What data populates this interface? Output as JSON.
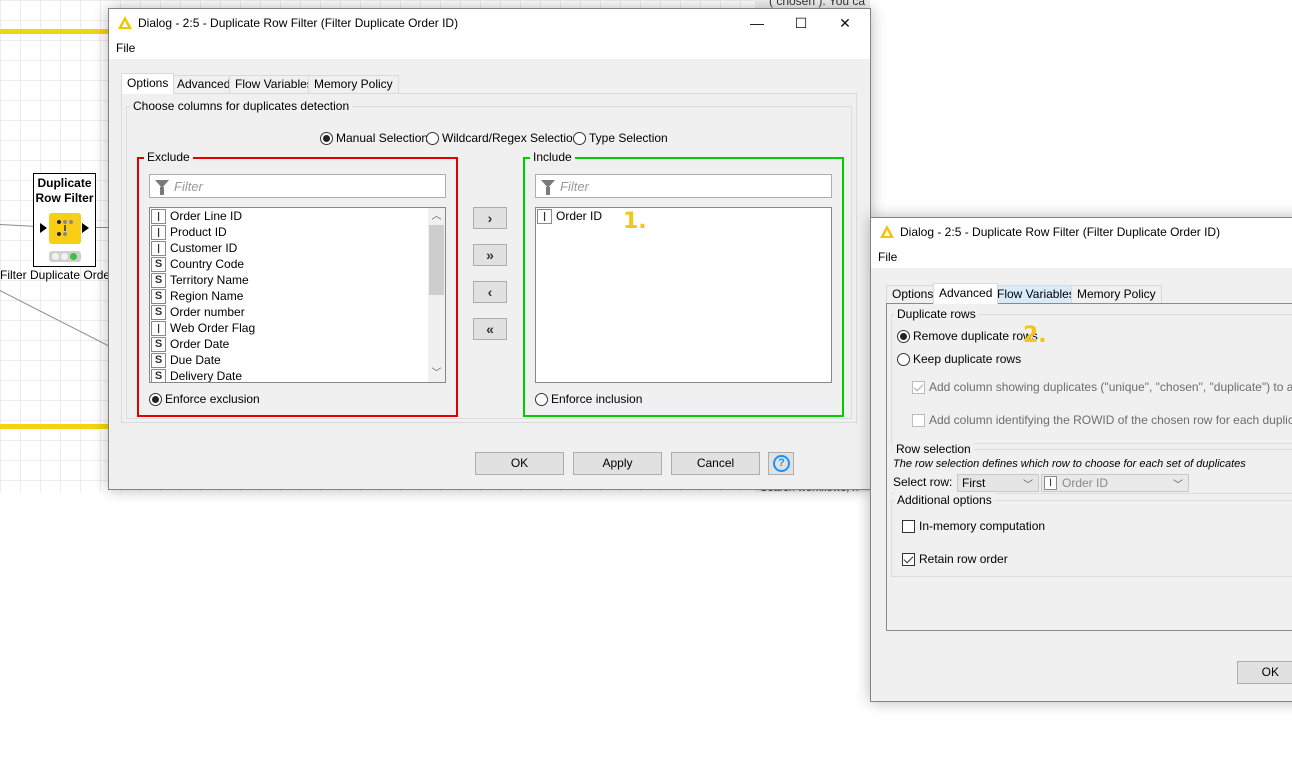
{
  "canvas": {
    "node": {
      "title_line1": "Duplicate",
      "title_line2": "Row Filter",
      "label": "Filter Duplicate Orde"
    },
    "background_snippets": {
      "top_right": "( chosen ). You ca",
      "search_hint": "Search workflows, n"
    }
  },
  "dialog1": {
    "title": "Dialog - 2:5 - Duplicate Row Filter (Filter Duplicate Order ID)",
    "menu": {
      "file": "File"
    },
    "window_controls": {
      "minimize": "—",
      "maximize": "☐",
      "close": "✕"
    },
    "tabs": [
      {
        "label": "Options",
        "active": true
      },
      {
        "label": "Advanced",
        "active": false
      },
      {
        "label": "Flow Variables",
        "active": false
      },
      {
        "label": "Memory Policy",
        "active": false
      }
    ],
    "group_title": "Choose columns for duplicates detection",
    "selection_modes": [
      {
        "label": "Manual Selection",
        "selected": true
      },
      {
        "label": "Wildcard/Regex Selection",
        "selected": false
      },
      {
        "label": "Type Selection",
        "selected": false
      }
    ],
    "exclude": {
      "title": "Exclude",
      "border_color": "#e00000",
      "filter_placeholder": "Filter",
      "items": [
        {
          "type": "I",
          "name": "Order Line ID"
        },
        {
          "type": "I",
          "name": "Product ID"
        },
        {
          "type": "I",
          "name": "Customer ID"
        },
        {
          "type": "S",
          "name": "Country Code"
        },
        {
          "type": "S",
          "name": "Territory Name"
        },
        {
          "type": "S",
          "name": "Region Name"
        },
        {
          "type": "S",
          "name": "Order number"
        },
        {
          "type": "I",
          "name": "Web Order Flag"
        },
        {
          "type": "S",
          "name": "Order Date"
        },
        {
          "type": "S",
          "name": "Due Date"
        },
        {
          "type": "S",
          "name": "Delivery Date"
        }
      ],
      "enforce_label": "Enforce exclusion",
      "enforce_selected": true
    },
    "move_buttons": {
      "add": "›",
      "add_all": "»",
      "remove": "‹",
      "remove_all": "«"
    },
    "include": {
      "title": "Include",
      "border_color": "#00cc00",
      "filter_placeholder": "Filter",
      "items": [
        {
          "type": "I",
          "name": "Order ID"
        }
      ],
      "enforce_label": "Enforce inclusion",
      "enforce_selected": false
    },
    "step_label": "1.",
    "buttons": {
      "ok": "OK",
      "apply": "Apply",
      "cancel": "Cancel",
      "help": "?"
    }
  },
  "dialog2": {
    "title": "Dialog - 2:5 - Duplicate Row Filter (Filter Duplicate Order ID)",
    "menu": {
      "file": "File"
    },
    "tabs": [
      {
        "label": "Options",
        "active": false
      },
      {
        "label": "Advanced",
        "active": true
      },
      {
        "label": "Flow Variables",
        "active": false,
        "hover": true
      },
      {
        "label": "Memory Policy",
        "active": false
      }
    ],
    "duplicate_rows": {
      "title": "Duplicate rows",
      "remove_label": "Remove duplicate rows",
      "remove_selected": true,
      "keep_label": "Keep duplicate rows",
      "keep_selected": false,
      "add_column_label": "Add column showing duplicates (\"unique\", \"chosen\", \"duplicate\") to all rows",
      "add_column_checked": true,
      "add_rowid_label": "Add column identifying the ROWID of the chosen row for each duplicate row",
      "add_rowid_checked": false
    },
    "step_label": "2.",
    "row_selection": {
      "title": "Row selection",
      "description": "The row selection defines which row to choose for each set of duplicates",
      "select_row_label": "Select row:",
      "select_row_value": "First",
      "column_type": "I",
      "column_value": "Order ID"
    },
    "additional_options": {
      "title": "Additional options",
      "in_memory_label": "In-memory computation",
      "in_memory_checked": false,
      "retain_order_label": "Retain row order",
      "retain_order_checked": true
    },
    "buttons": {
      "ok": "OK"
    }
  },
  "colors": {
    "accent_yellow": "#f5c518",
    "knime_yellow": "#f8cf14",
    "exclude_red": "#e00000",
    "include_green": "#00cc00",
    "help_blue": "#1e90ff"
  }
}
